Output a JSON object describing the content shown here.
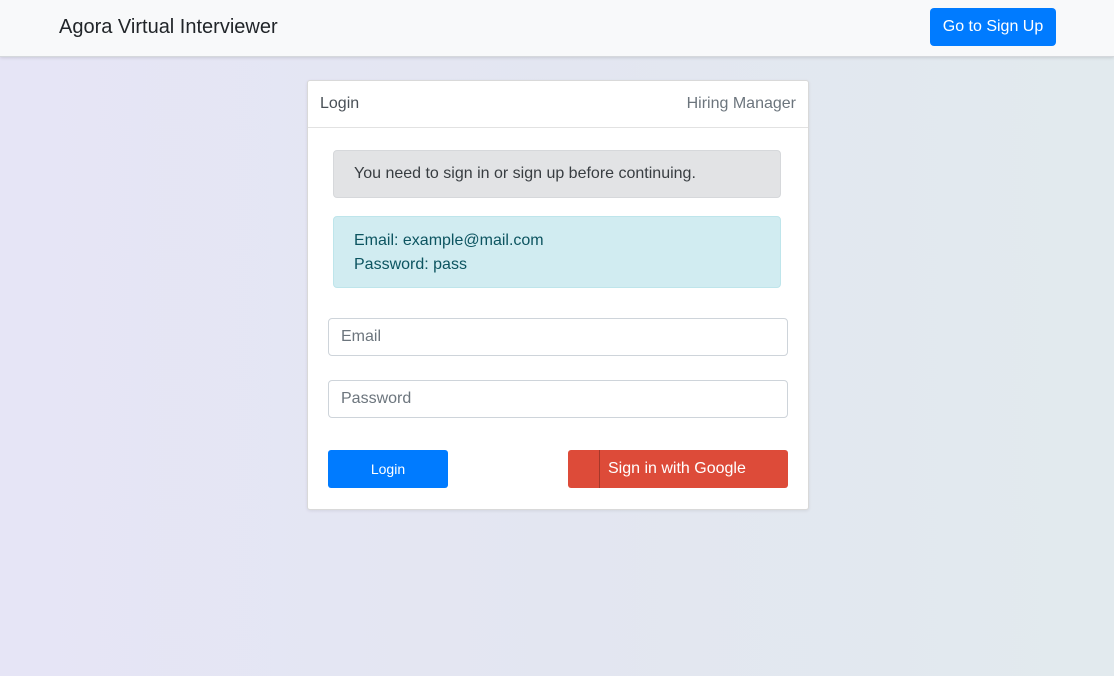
{
  "navbar": {
    "brand": "Agora Virtual Interviewer",
    "signup_label": "Go to Sign Up"
  },
  "card": {
    "tabs": {
      "login": "Login",
      "hiring_manager": "Hiring Manager"
    },
    "notice": "You need to sign in or sign up before continuing.",
    "demo_credentials": {
      "email_line": "Email: example@mail.com",
      "password_line": "Password: pass"
    },
    "form": {
      "email_placeholder": "Email",
      "password_placeholder": "Password",
      "login_label": "Login",
      "google_label": "Sign in with Google"
    }
  },
  "colors": {
    "primary": "#007bff",
    "google": "#dd4b39",
    "notice_bg": "#e2e3e5",
    "info_bg": "#d1ecf1"
  },
  "icons": {
    "google_button_icon": "google-icon"
  }
}
